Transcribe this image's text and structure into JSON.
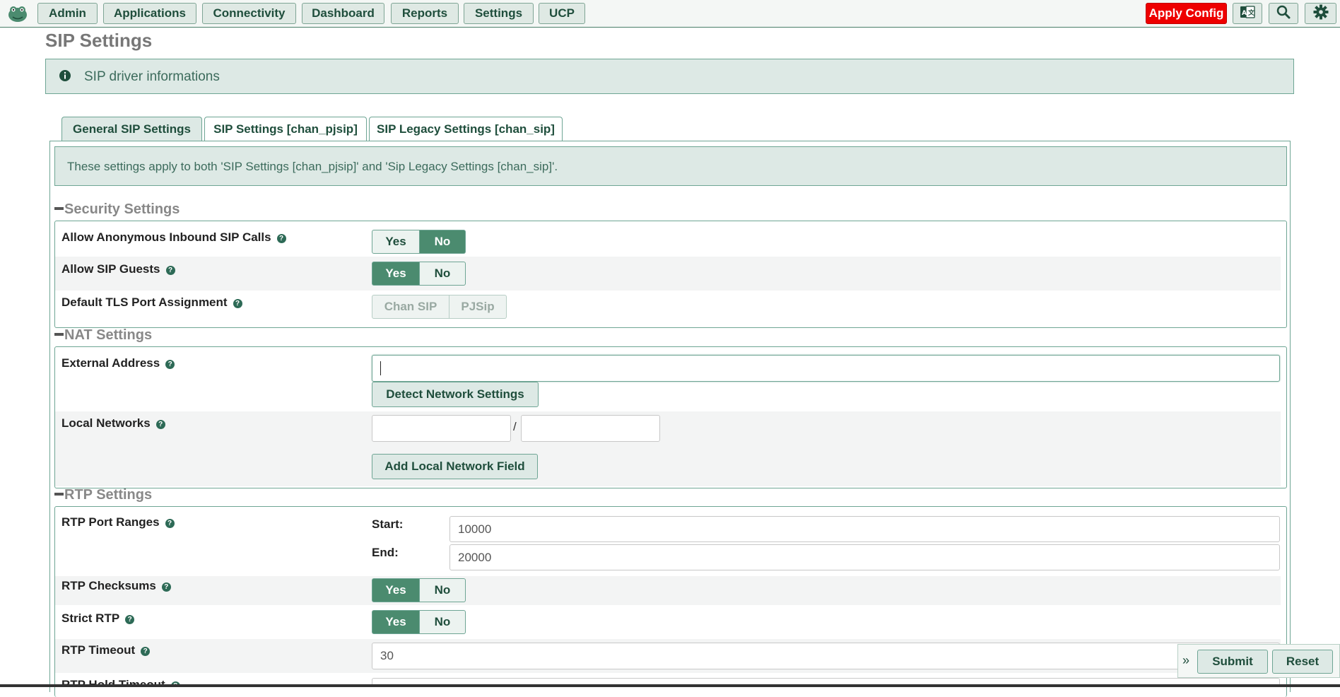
{
  "nav": {
    "items": [
      "Admin",
      "Applications",
      "Connectivity",
      "Dashboard",
      "Reports",
      "Settings",
      "UCP"
    ],
    "apply_config": "Apply Config",
    "icons": [
      "language-icon",
      "search-icon",
      "gear-icon"
    ]
  },
  "page": {
    "title": "SIP Settings",
    "info_text": "SIP driver informations"
  },
  "tabs": [
    {
      "label": "General SIP Settings",
      "active": true
    },
    {
      "label": "SIP Settings [chan_pjsip]",
      "active": false
    },
    {
      "label": "SIP Legacy Settings [chan_sip]",
      "active": false
    }
  ],
  "note": "These settings apply to both 'SIP Settings [chan_pjsip]' and 'Sip Legacy Settings [chan_sip]'.",
  "security": {
    "title": "Security Settings",
    "anon_label": "Allow Anonymous Inbound SIP Calls",
    "anon_yes": "Yes",
    "anon_no": "No",
    "anon_value": "No",
    "guests_label": "Allow SIP Guests",
    "guests_yes": "Yes",
    "guests_no": "No",
    "guests_value": "Yes",
    "tls_label": "Default TLS Port Assignment",
    "tls_opt1": "Chan SIP",
    "tls_opt2": "PJSip"
  },
  "nat": {
    "title": "NAT Settings",
    "external_label": "External Address",
    "external_value": "",
    "detect_button": "Detect Network Settings",
    "local_label": "Local Networks",
    "local_ip": "",
    "local_mask": "",
    "slash": "/",
    "add_button": "Add Local Network Field"
  },
  "rtp": {
    "title": "RTP Settings",
    "ranges_label": "RTP Port Ranges",
    "start_label": "Start:",
    "start_value": "10000",
    "end_label": "End:",
    "end_value": "20000",
    "checksums_label": "RTP Checksums",
    "checksums_yes": "Yes",
    "checksums_no": "No",
    "checksums_value": "Yes",
    "strict_label": "Strict RTP",
    "strict_yes": "Yes",
    "strict_no": "No",
    "strict_value": "Yes",
    "timeout_label": "RTP Timeout",
    "timeout_value": "30",
    "hold_label": "RTP Hold Timeout"
  },
  "footer": {
    "expand": "»",
    "submit": "Submit",
    "reset": "Reset"
  },
  "colors": {
    "accent": "#4b8b6f",
    "apply": "#ee0000",
    "panel": "#dde9e5"
  }
}
